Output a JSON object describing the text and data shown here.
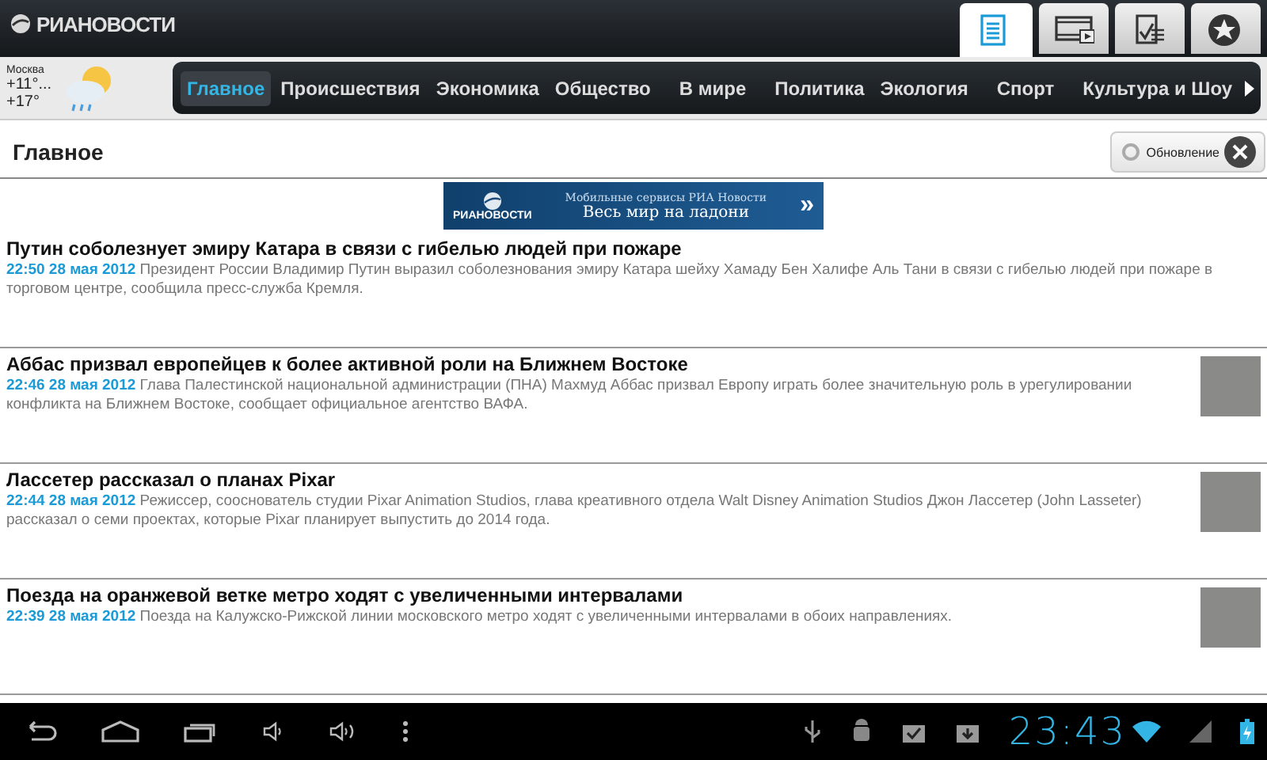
{
  "header": {
    "logo": "РИАНОВОСТИ",
    "tabs": [
      {
        "kind": "news",
        "selected": true
      },
      {
        "kind": "video",
        "selected": false
      },
      {
        "kind": "poll",
        "selected": false
      },
      {
        "kind": "favorites",
        "selected": false
      }
    ]
  },
  "weather": {
    "city": "Москва",
    "temp_1": "+11°...",
    "temp_2": "+17°"
  },
  "categories": [
    {
      "label": "Главное",
      "selected": true
    },
    {
      "label": "Происшествия",
      "selected": false
    },
    {
      "label": "Экономика",
      "selected": false
    },
    {
      "label": "Общество",
      "selected": false
    },
    {
      "label": "В мире",
      "selected": false
    },
    {
      "label": "Политика",
      "selected": false
    },
    {
      "label": "Экология",
      "selected": false
    },
    {
      "label": "Спорт",
      "selected": false
    },
    {
      "label": "Культура и Шоу",
      "selected": false
    }
  ],
  "section": {
    "title": "Главное",
    "refresh_label": "Обновление"
  },
  "banner": {
    "logo": "РИАНОВОСТИ",
    "line_1": "Мобильные сервисы РИА Новости",
    "line_2": "Весь мир на ладони",
    "arrow": "»"
  },
  "news": [
    {
      "title": "Путин соболезнует эмиру Катара в связи с гибелью людей при пожаре",
      "time": "22:50 28 мая 2012",
      "summary": "Президент России Владимир Путин выразил соболезнования эмиру Катара шейху Хамаду Бен Халифе Аль Тани в связи с гибелью людей при пожаре в торговом центре, сообщила пресс-служба Кремля.",
      "photo": false
    },
    {
      "title": "Аббас призвал европейцев к более активной роли на Ближнем Востоке",
      "time": "22:46 28 мая 2012",
      "summary": "Глава Палестинской национальной администрации (ПНА) Махмуд Аббас призвал Европу играть более значительную роль в урегулировании конфликта на Ближнем Востоке, сообщает официальное агентство ВАФА.",
      "photo": true
    },
    {
      "title": "Лассетер рассказал о планах Pixar",
      "time": "22:44 28 мая 2012",
      "summary": "Режиссер, сооснователь студии Pixar Animation Studios, глава креативного отдела Walt Disney Animation Studios Джон Лассетер (John Lasseter) рассказал о семи проектах, которые Pixar планирует выпустить до 2014 года.",
      "photo": true
    },
    {
      "title": "Поезда на оранжевой ветке метро ходят с увеличенными интервалами",
      "time": "22:39 28 мая 2012",
      "summary": "Поезда на Калужско-Рижской линии московского метро ходят с увеличенными интервалами в обоих направлениях.",
      "photo": true
    }
  ],
  "system_bar": {
    "clock": "23:43"
  }
}
